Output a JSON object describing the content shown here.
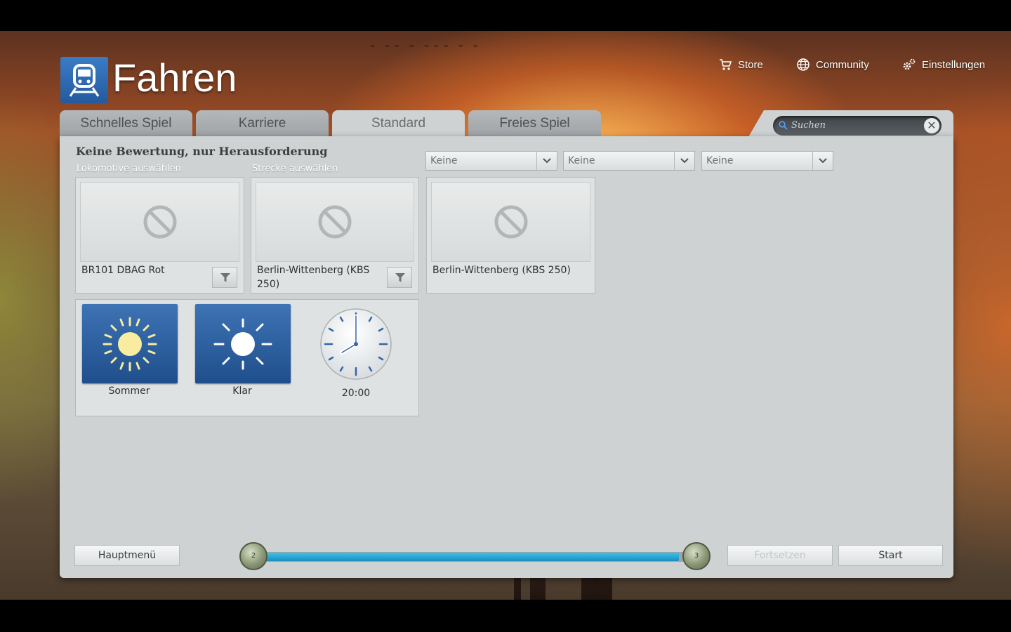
{
  "app": {
    "title": "Fahren",
    "logo_icon": "train-icon"
  },
  "topnav": [
    {
      "label": "Store",
      "icon": "cart-icon"
    },
    {
      "label": "Community",
      "icon": "globe-icon"
    },
    {
      "label": "Einstellungen",
      "icon": "gears-icon"
    }
  ],
  "tabs": [
    {
      "label": "Schnelles Spiel",
      "active": false
    },
    {
      "label": "Karriere",
      "active": false
    },
    {
      "label": "Standard",
      "active": true
    },
    {
      "label": "Freies Spiel",
      "active": false
    }
  ],
  "search": {
    "placeholder": "Suchen"
  },
  "content": {
    "heading": "Keine Bewertung, nur Herausforderung",
    "loco_label": "Lokomotive auswählen",
    "route_label": "Strecke auswählen",
    "dropdowns": [
      "Keine",
      "Keine",
      "Keine"
    ],
    "cards": [
      {
        "name": "BR101 DBAG Rot"
      },
      {
        "name": "Berlin-Wittenberg (KBS 250)"
      },
      {
        "name": "Berlin-Wittenberg (KBS 250)"
      }
    ],
    "season": {
      "label": "Sommer",
      "icon": "sun-icon"
    },
    "weather": {
      "label": "Klar",
      "icon": "clear-sun-icon"
    },
    "time": {
      "label": "20:00",
      "icon": "clock-icon"
    }
  },
  "footer": {
    "main_menu": "Hauptmenü",
    "continue": "Fortsetzen",
    "start": "Start",
    "step_from": "2",
    "step_to": "3",
    "progress": 0.96
  },
  "colors": {
    "accent_blue": "#2d65a8",
    "progress": "#2bb0e0"
  }
}
